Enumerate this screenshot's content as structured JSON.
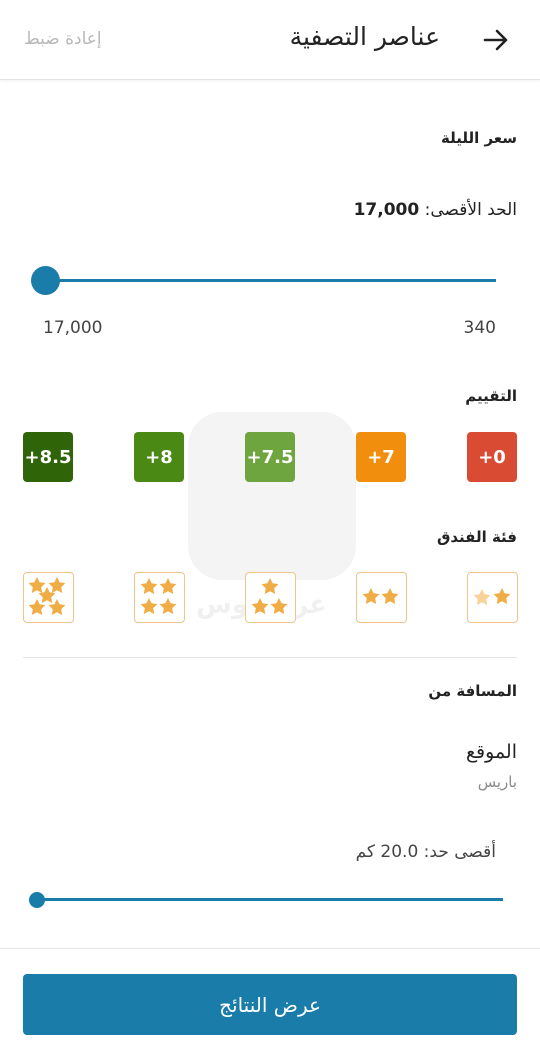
{
  "header": {
    "title": "عناصر التصفية",
    "reset_label": "إعادة ضبط",
    "back_icon": "arrow-right-icon"
  },
  "price": {
    "title": "سعر الليلة",
    "max_label": "الحد الأقصى:",
    "max_value": "17,000",
    "range_low": "17,000",
    "range_high": "340",
    "slider_fraction": 0.0
  },
  "rating": {
    "title": "التقييم",
    "options": [
      {
        "label": "+8.5",
        "color": "#2f6408"
      },
      {
        "label": "+8",
        "color": "#4a8a14"
      },
      {
        "label": "+7.5",
        "color": "#6fa53e"
      },
      {
        "label": "+7",
        "color": "#f28e0d"
      },
      {
        "label": "+0",
        "color": "#d94b32"
      }
    ]
  },
  "hotel_class": {
    "title": "فئة الفندق",
    "options": [
      5,
      4,
      3,
      2,
      1
    ],
    "star_color": "#f0ad45"
  },
  "distance": {
    "title": "المسافة من",
    "location_label": "الموقع",
    "location_value": "باريس",
    "max_label": "أقصى حد:",
    "max_value": "20.0 كم",
    "slider_fraction": 0.0
  },
  "footer": {
    "cta_label": "عرض النتائج"
  },
  "accent": "#1a7ca8"
}
